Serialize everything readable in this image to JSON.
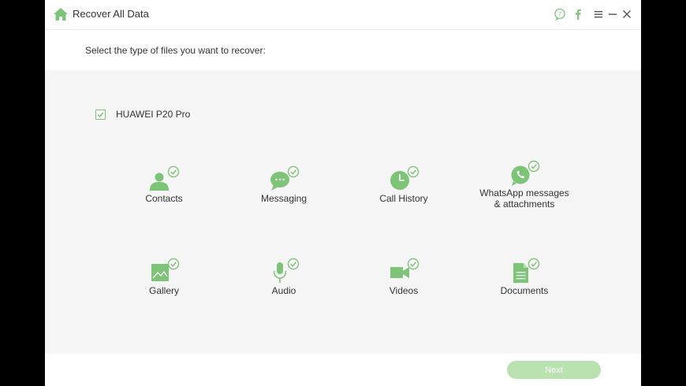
{
  "window": {
    "title": "Recover All Data",
    "icons": [
      "home-icon",
      "feedback-icon",
      "facebook-icon",
      "menu-icon",
      "minimize-icon",
      "close-icon"
    ]
  },
  "header": {
    "subtitle": "Select the type of files you want to recover:"
  },
  "device": {
    "name": "HUAWEI P20 Pro",
    "checked": true
  },
  "file_types": [
    {
      "label": "Contacts",
      "icon": "contacts-icon",
      "checked": true
    },
    {
      "label": "Messaging",
      "icon": "messaging-icon",
      "checked": true
    },
    {
      "label": "Call History",
      "icon": "call-history-icon",
      "checked": true
    },
    {
      "label": "WhatsApp messages\n& attachments",
      "icon": "whatsapp-icon",
      "checked": true
    },
    {
      "label": "Gallery",
      "icon": "gallery-icon",
      "checked": true
    },
    {
      "label": "Audio",
      "icon": "audio-icon",
      "checked": true
    },
    {
      "label": "Videos",
      "icon": "videos-icon",
      "checked": true
    },
    {
      "label": "Documents",
      "icon": "documents-icon",
      "checked": true
    }
  ],
  "footer": {
    "next_label": "Next"
  },
  "colors": {
    "accent": "#7cc576",
    "next_button": "#b8e2b0",
    "panel_bg": "#f5f5f5"
  }
}
